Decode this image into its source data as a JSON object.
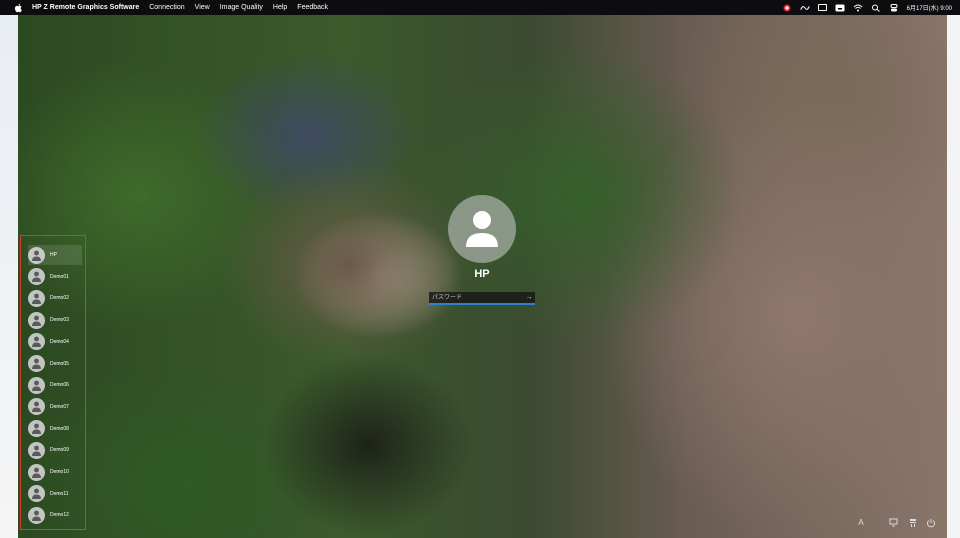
{
  "menubar": {
    "app_name": "HP Z Remote Graphics Software",
    "items": [
      "Connection",
      "View",
      "Image Quality",
      "Help",
      "Feedback"
    ],
    "date_time": "6月17日(水)  9:00",
    "status_icons": [
      "record-icon",
      "meta-icon",
      "battery-icon",
      "keyboard-icon",
      "wifi-icon",
      "search-icon",
      "control-center-icon"
    ]
  },
  "login": {
    "user_name": "HP",
    "password_placeholder": "パスワード",
    "submit_glyph": "→"
  },
  "users": [
    {
      "label": "HP",
      "selected": true
    },
    {
      "label": "Demo01"
    },
    {
      "label": "Demo02"
    },
    {
      "label": "Demo03"
    },
    {
      "label": "Demo04"
    },
    {
      "label": "Demo05"
    },
    {
      "label": "Demo06"
    },
    {
      "label": "Demo07"
    },
    {
      "label": "Demo08"
    },
    {
      "label": "Demo09"
    },
    {
      "label": "Demo10"
    },
    {
      "label": "Demo11"
    },
    {
      "label": "Demo12"
    }
  ],
  "bottom_icons": {
    "language": "A",
    "network": "network-icon",
    "accessibility": "accessibility-icon",
    "power": "power-icon"
  },
  "colors": {
    "highlight_border": "#d93b2b",
    "focus_underline": "#2f7fd0"
  }
}
